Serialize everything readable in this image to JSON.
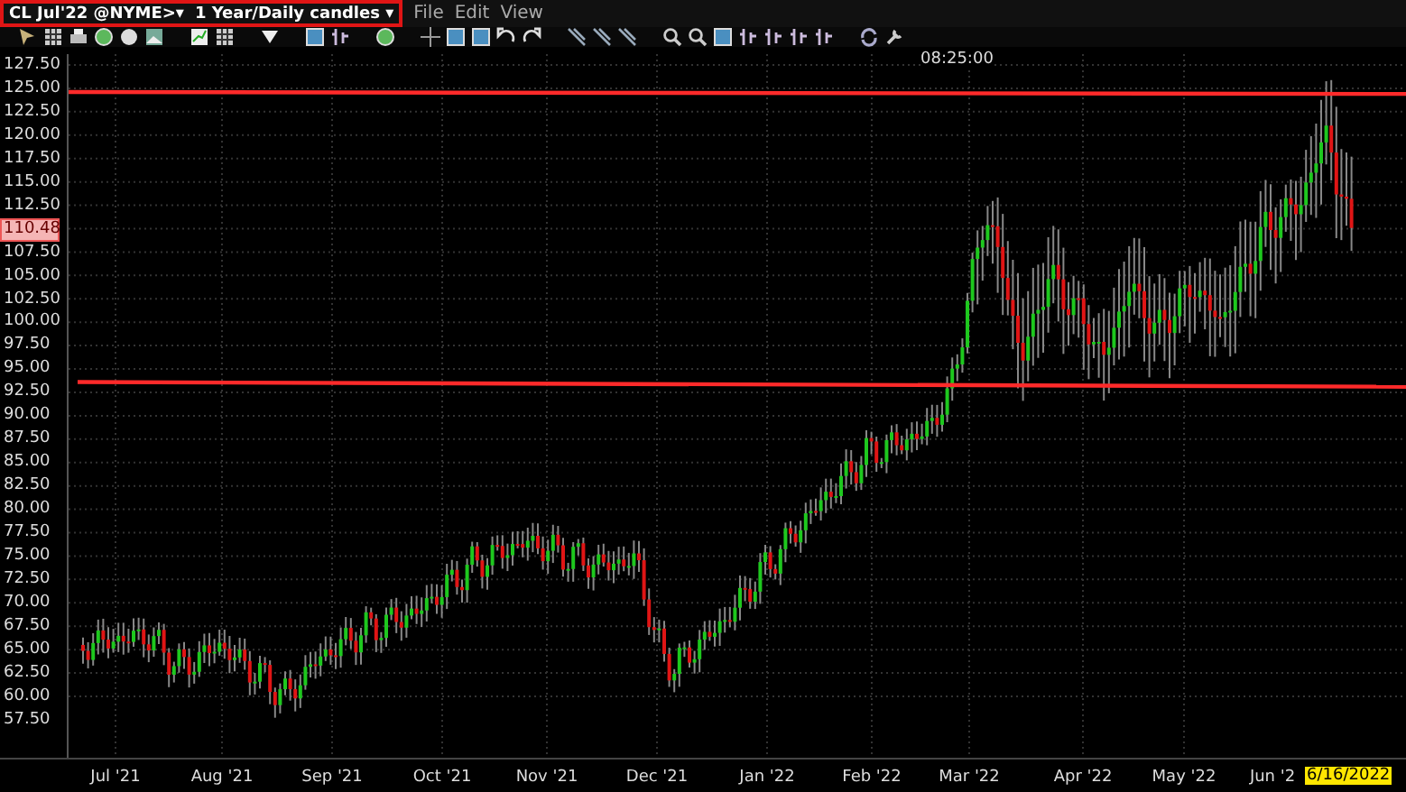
{
  "symbol_selector": {
    "symbol": "CL Jul'22 @NYME>▾",
    "period": "1 Year/Daily candles ▾"
  },
  "menu": [
    "File",
    "Edit",
    "View"
  ],
  "chart": {
    "time_label": "08:25:00",
    "y_axis": [
      {
        "text": "127.50",
        "current": false
      },
      {
        "text": "125.00",
        "current": false
      },
      {
        "text": "122.50",
        "current": false
      },
      {
        "text": "120.00",
        "current": false
      },
      {
        "text": "117.50",
        "current": false
      },
      {
        "text": "115.00",
        "current": false
      },
      {
        "text": "112.50",
        "current": false
      },
      {
        "text": "110.48",
        "current": true
      },
      {
        "text": "107.50",
        "current": false
      },
      {
        "text": "105.00",
        "current": false
      },
      {
        "text": "102.50",
        "current": false
      },
      {
        "text": "100.00",
        "current": false
      },
      {
        "text": "97.50",
        "current": false
      },
      {
        "text": "95.00",
        "current": false
      },
      {
        "text": "92.50",
        "current": false
      },
      {
        "text": "90.00",
        "current": false
      },
      {
        "text": "87.50",
        "current": false
      },
      {
        "text": "85.00",
        "current": false
      },
      {
        "text": "82.50",
        "current": false
      },
      {
        "text": "80.00",
        "current": false
      },
      {
        "text": "77.50",
        "current": false
      },
      {
        "text": "75.00",
        "current": false
      },
      {
        "text": "72.50",
        "current": false
      },
      {
        "text": "70.00",
        "current": false
      },
      {
        "text": "67.50",
        "current": false
      },
      {
        "text": "65.00",
        "current": false
      },
      {
        "text": "62.50",
        "current": false
      },
      {
        "text": "60.00",
        "current": false
      },
      {
        "text": "57.50",
        "current": false
      }
    ],
    "x_axis": [
      "Jul '21",
      "Aug '21",
      "Sep '21",
      "Oct '21",
      "Nov '21",
      "Dec '21",
      "Jan '22",
      "Feb '22",
      "Mar '22",
      "Apr '22",
      "May '22",
      "Jun '2"
    ],
    "date_marker": "6/16/2022"
  }
}
